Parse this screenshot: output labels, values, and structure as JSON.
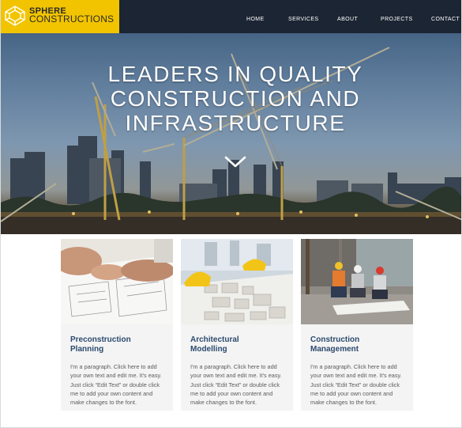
{
  "brand": {
    "line1": "SPHERE",
    "line2": "CONSTRUCTIONS",
    "accent": "#f2c400",
    "header_bg": "#1c2533"
  },
  "nav": {
    "items": [
      "HOME",
      "SERVICES",
      "ABOUT",
      "PROJECTS",
      "CONTACT"
    ]
  },
  "hero": {
    "title": "LEADERS IN QUALITY\nCONSTRUCTION AND\nINFRASTRUCTURE",
    "scroll_icon": "chevron-down-icon"
  },
  "cards": [
    {
      "title": "Preconstruction\nPlanning",
      "text": "I'm a paragraph. Click here to add your own text and edit me. It's easy. Just click “Edit Text” or double click me to add your own content and make changes to the font."
    },
    {
      "title": "Architectural\nModelling",
      "text": "I'm a paragraph. Click here to add your own text and edit me. It's easy. Just click “Edit Text” or double click me to add your own content and make changes to the font."
    },
    {
      "title": "Construction\nManagement",
      "text": "I'm a paragraph. Click here to add your own text and edit me. It's easy. Just click “Edit Text” or double click me to add your own content and make changes to the font."
    }
  ]
}
